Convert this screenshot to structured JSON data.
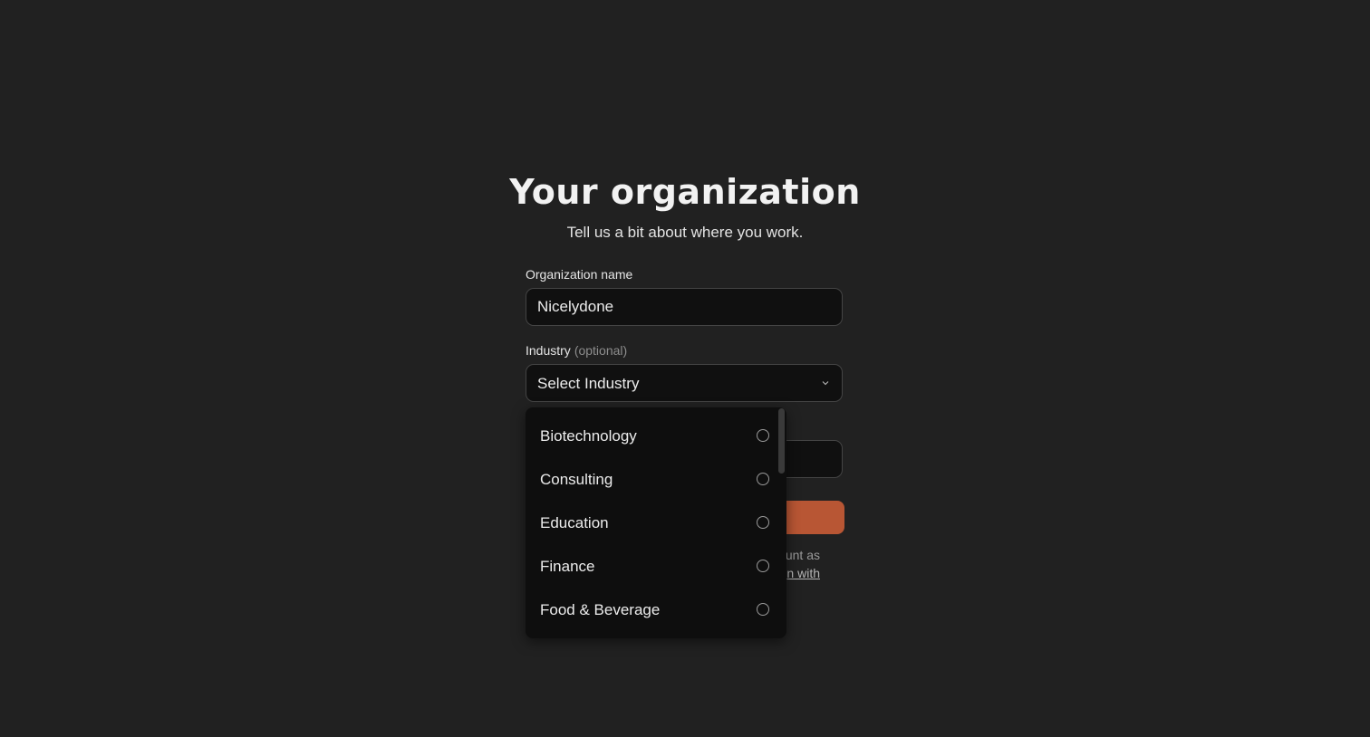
{
  "header": {
    "title": "Your organization",
    "subtitle": "Tell us a bit about where you work."
  },
  "form": {
    "org_name_label": "Organization name",
    "org_name_value": "Nicelydone",
    "industry_label": "Industry",
    "industry_optional": "(optional)",
    "industry_placeholder": "Select Industry",
    "footnote_visible_1": "unt as",
    "footnote_visible_2": "n with"
  },
  "dropdown": {
    "options": [
      {
        "label": "Biotechnology",
        "selected": false
      },
      {
        "label": "Consulting",
        "selected": false
      },
      {
        "label": "Education",
        "selected": false
      },
      {
        "label": "Finance",
        "selected": false
      },
      {
        "label": "Food & Beverage",
        "selected": false
      }
    ]
  },
  "colors": {
    "background": "#212121",
    "field_background": "#101010",
    "accent": "#b85634",
    "dropdown_background": "#0e0e0e"
  },
  "icons": {
    "select_chevron": "chevron-down-icon",
    "option_radio": "radio-unchecked-icon"
  }
}
